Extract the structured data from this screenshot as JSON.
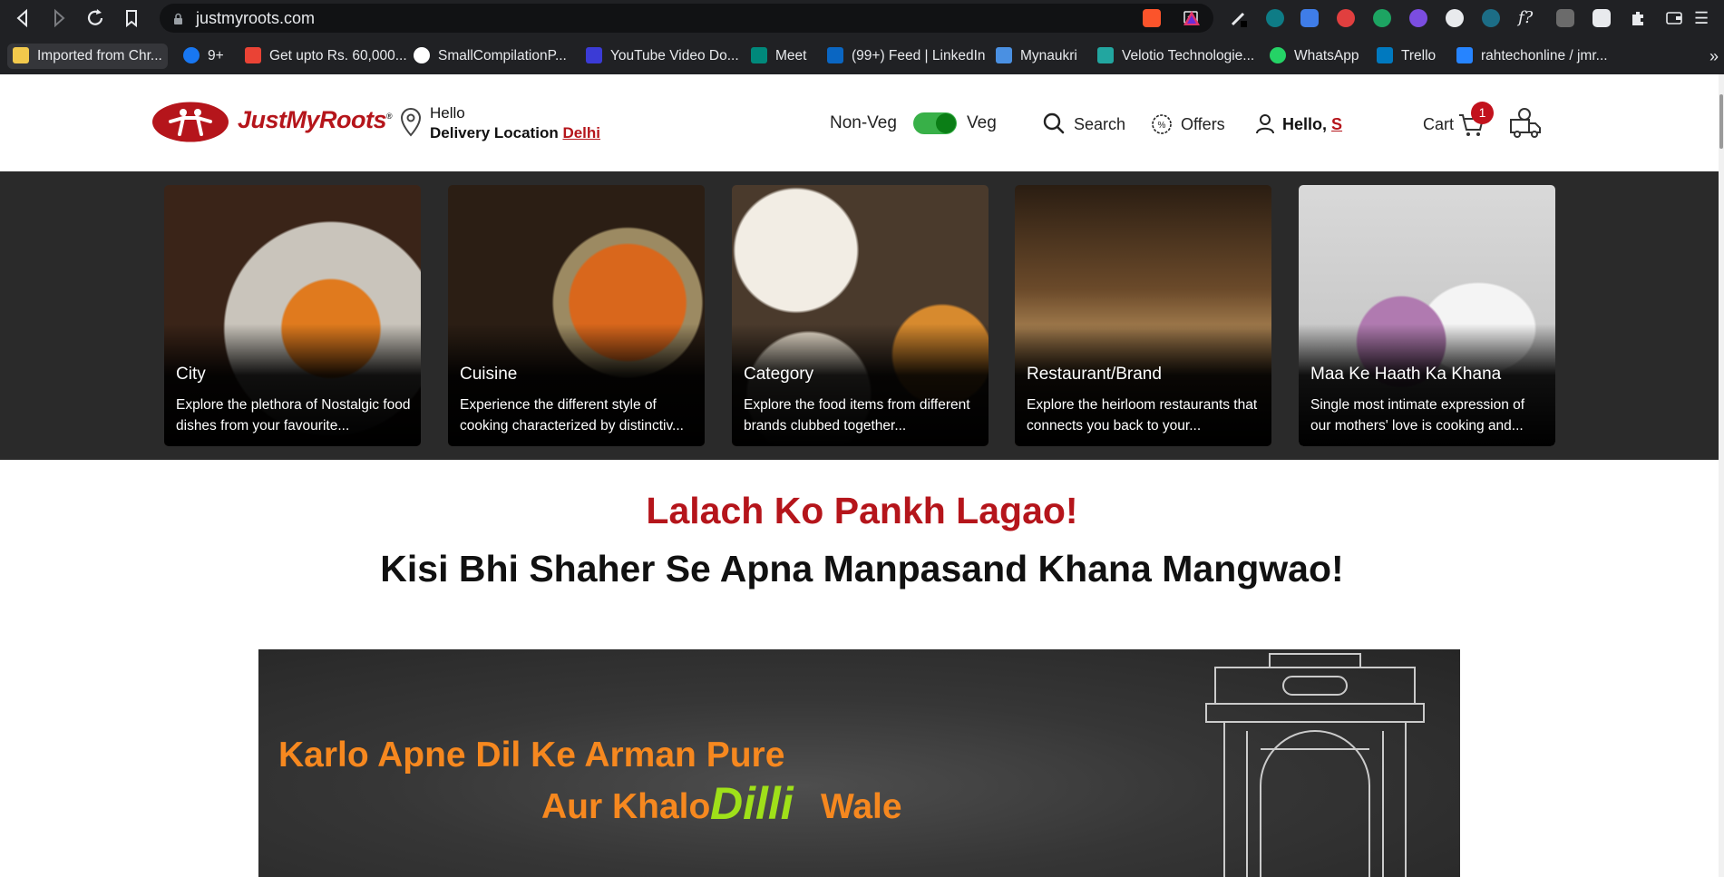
{
  "browser": {
    "url": "justmyroots.com",
    "bookmarks": [
      {
        "label": "Imported from Chr...",
        "icon": "folder-icon",
        "color": "#f2c94c"
      },
      {
        "label": "9+",
        "icon": "facebook-icon",
        "color": "#1877f2"
      },
      {
        "label": "Get upto Rs. 60,000...",
        "icon": "gmail-icon",
        "color": "#ea4335"
      },
      {
        "label": "SmallCompilationP...",
        "icon": "github-icon",
        "color": "#ffffff"
      },
      {
        "label": "YouTube Video Do...",
        "icon": "video-download-icon",
        "color": "#3b3bd6"
      },
      {
        "label": "Meet",
        "icon": "meet-icon",
        "color": "#00897b"
      },
      {
        "label": "(99+) Feed | LinkedIn",
        "icon": "linkedin-icon",
        "color": "#0a66c2"
      },
      {
        "label": "Mynaukri",
        "icon": "naukri-icon",
        "color": "#4a90e2"
      },
      {
        "label": "Velotio Technologie...",
        "icon": "velotio-icon",
        "color": "#22a6a0"
      },
      {
        "label": "WhatsApp",
        "icon": "whatsapp-icon",
        "color": "#25d366"
      },
      {
        "label": "Trello",
        "icon": "trello-icon",
        "color": "#0079bf"
      },
      {
        "label": "rahtechonline / jmr...",
        "icon": "bitbucket-icon",
        "color": "#2684ff"
      }
    ]
  },
  "header": {
    "logo_text": "JustMyRoots",
    "greeting": "Hello",
    "delivery_label": "Delivery Location",
    "delivery_city": "Delhi",
    "nonveg_label": "Non-Veg",
    "veg_label": "Veg",
    "veg_toggle_on": true,
    "search_label": "Search",
    "offers_label": "Offers",
    "user_greeting": "Hello,",
    "user_initial": "S",
    "cart_label": "Cart",
    "cart_count": "1"
  },
  "categories": [
    {
      "title": "City",
      "desc": "Explore the plethora of Nostalgic food dishes from your favourite..."
    },
    {
      "title": "Cuisine",
      "desc": "Experience the different style of cooking characterized by distinctiv..."
    },
    {
      "title": "Category",
      "desc": "Explore the food items from different brands clubbed together..."
    },
    {
      "title": "Restaurant/Brand",
      "desc": "Explore the heirloom restaurants that connects you back to your..."
    },
    {
      "title": "Maa Ke Haath Ka Khana",
      "desc": "Single most intimate expression of our mothers' love is cooking and..."
    }
  ],
  "hero": {
    "tagline_1": "Lalach Ko Pankh Lagao!",
    "tagline_2": "Kisi Bhi Shaher Se Apna Manpasand Khana Mangwao!"
  },
  "banner": {
    "line_1": "Karlo Apne Dil Ke Arman Pure",
    "line_2a": "Aur Khalo",
    "highlight": "Dilli",
    "line_2b": "Wale"
  },
  "colors": {
    "brand_red": "#b5151b",
    "toggle_green": "#38b048",
    "banner_orange": "#f6881f",
    "banner_green": "#9fe019"
  }
}
